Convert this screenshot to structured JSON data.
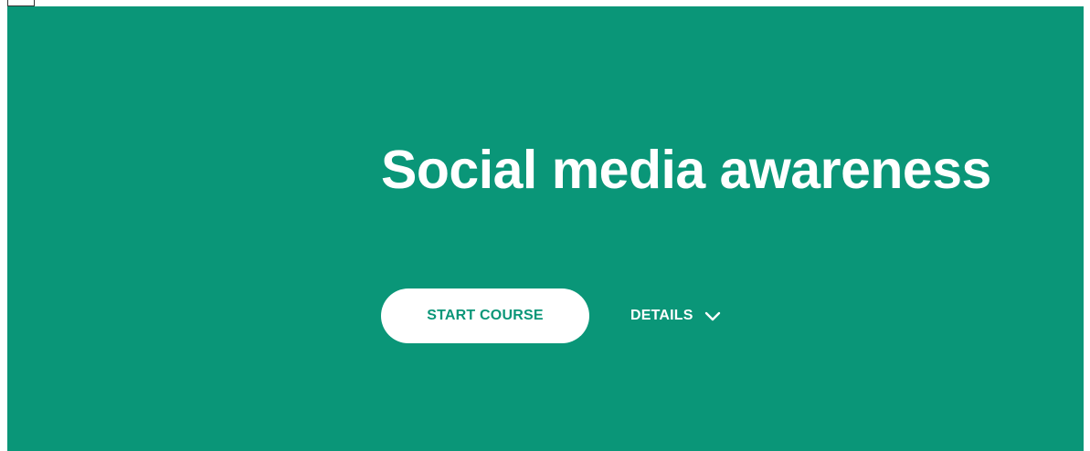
{
  "hero": {
    "title": "Social media awareness",
    "start_label": "START COURSE",
    "details_label": "DETAILS",
    "details_icon": "chevron-down-icon"
  },
  "colors": {
    "hero_background": "#0a9678",
    "button_background": "#ffffff",
    "button_text": "#0a9678",
    "text": "#ffffff"
  }
}
